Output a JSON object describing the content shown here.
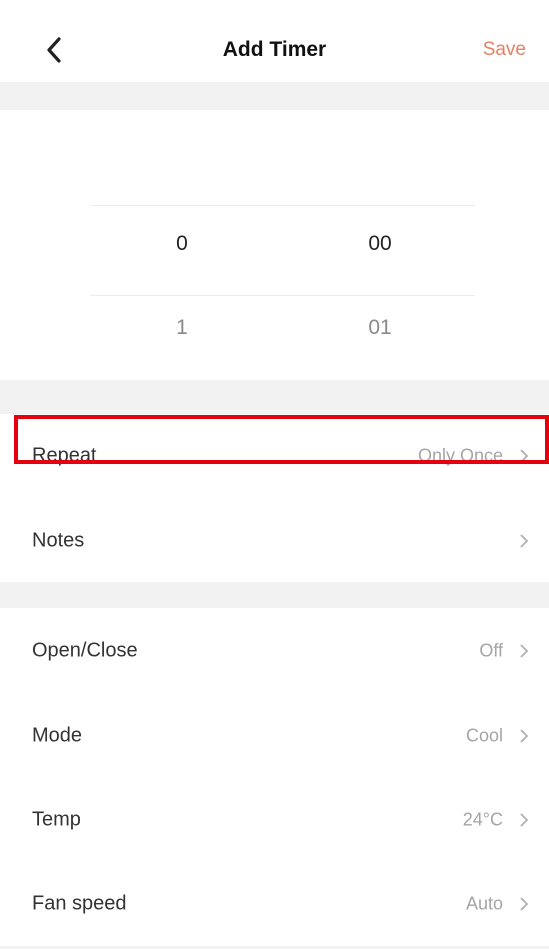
{
  "header": {
    "title": "Add Timer",
    "save_label": "Save",
    "back_icon": "chevron-left-icon"
  },
  "picker": {
    "hours": {
      "selected": "0",
      "next": "1"
    },
    "minutes": {
      "selected": "00",
      "next": "01"
    }
  },
  "timer_settings": [
    {
      "label": "Repeat",
      "value": "Only Once"
    },
    {
      "label": "Notes",
      "value": ""
    }
  ],
  "device_settings": [
    {
      "label": "Open/Close",
      "value": "Off"
    },
    {
      "label": "Mode",
      "value": "Cool"
    },
    {
      "label": "Temp",
      "value": "24°C"
    },
    {
      "label": "Fan speed",
      "value": "Auto"
    }
  ],
  "colors": {
    "accent": "#e87f62",
    "highlight": "#e3000f",
    "section_bg": "#f2f2f2"
  }
}
